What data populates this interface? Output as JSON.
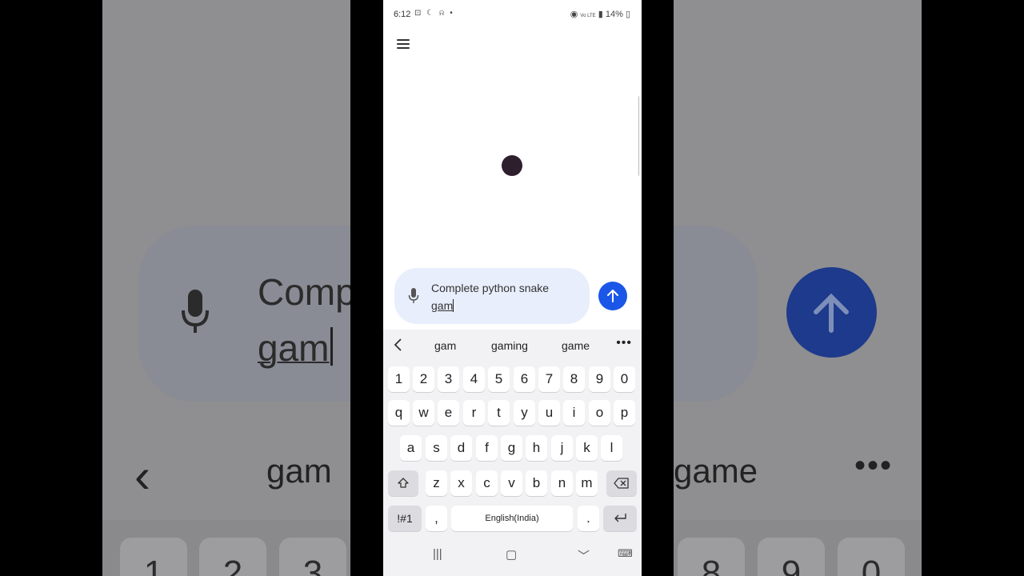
{
  "status_bar": {
    "time": "6:12",
    "left_icons": "⊡ ☾ ⍾ •",
    "network": "Vo LTE",
    "battery": "14%"
  },
  "composer": {
    "message_line1": "Complete python snake",
    "message_word": "gam"
  },
  "suggestions": [
    "gam",
    "gaming",
    "game"
  ],
  "keyboard": {
    "number_row": [
      "1",
      "2",
      "3",
      "4",
      "5",
      "6",
      "7",
      "8",
      "9",
      "0"
    ],
    "row1": [
      "q",
      "w",
      "e",
      "r",
      "t",
      "y",
      "u",
      "i",
      "o",
      "p"
    ],
    "row2": [
      "a",
      "s",
      "d",
      "f",
      "g",
      "h",
      "j",
      "k",
      "l"
    ],
    "row3": [
      "z",
      "x",
      "c",
      "v",
      "b",
      "n",
      "m"
    ],
    "symbols_label": "!#1",
    "comma": ",",
    "space_label": "English(India)",
    "period": ".",
    "shift_icon": "shift-icon",
    "backspace_icon": "backspace-icon",
    "enter_icon": "enter-icon"
  },
  "nav_bar": {
    "recents": "|||",
    "home": "▢",
    "back": "﹀",
    "keyboard": "⌨"
  },
  "background": {
    "text_line1": "Comp",
    "text_word": "gam",
    "suggestion_left": "gam",
    "suggestion_right": "game",
    "keys_left": [
      "1",
      "2",
      "3"
    ],
    "keys_right": [
      "8",
      "9",
      "0"
    ]
  },
  "colors": {
    "send_button": "#1a57e8",
    "composer_bg": "#e8eefb",
    "keyboard_bg": "#f2f2f4"
  }
}
